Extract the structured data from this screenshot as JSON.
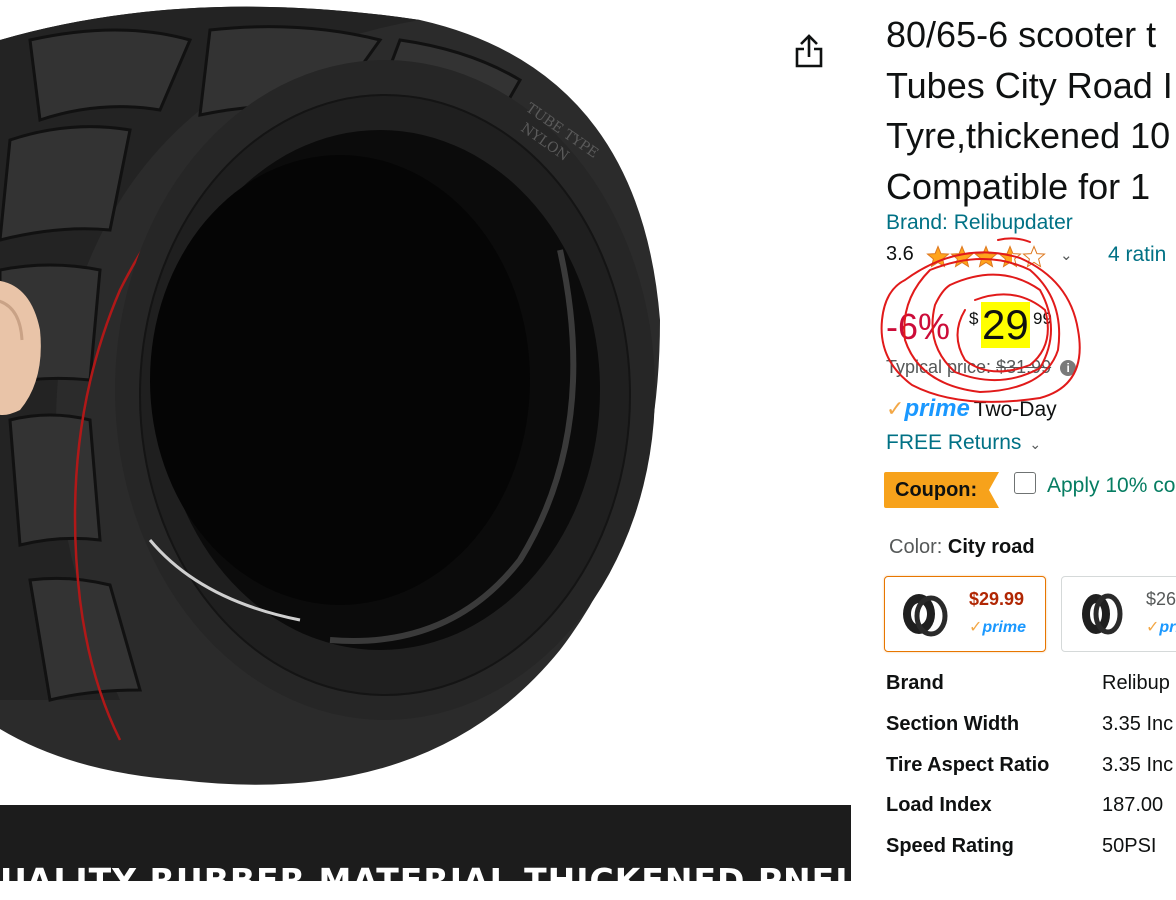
{
  "title": {
    "lines": [
      "80/65-6 scooter t",
      "Tubes City Road I",
      "Tyre,thickened 10",
      "Compatible for 1"
    ]
  },
  "brand": {
    "link_text": "Brand: Relibupdater"
  },
  "rating": {
    "value": "3.6",
    "stars": 3.6,
    "ratings_text": "4 ratin"
  },
  "price": {
    "discount": "-6%",
    "currency": "$",
    "whole": "29",
    "fraction": "99",
    "typical_label": "Typical price:",
    "typical_value": "$31.99"
  },
  "delivery": {
    "prime_label": "prime",
    "prime_delivery": "Two-Day",
    "free_returns": "FREE Returns"
  },
  "coupon": {
    "label": "Coupon:",
    "text": "Apply 10% co"
  },
  "color": {
    "label": "Color:",
    "value": "City road"
  },
  "swatches": [
    {
      "price": "$29.99",
      "prime": "prime"
    },
    {
      "price": "$26",
      "prime": "pri"
    }
  ],
  "specs": [
    {
      "key": "Brand",
      "value": "Relibup"
    },
    {
      "key": "Section Width",
      "value": "3.35 Inc"
    },
    {
      "key": "Tire Aspect Ratio",
      "value": "3.35 Inc"
    },
    {
      "key": "Load Index",
      "value": "187.00"
    },
    {
      "key": "Speed Rating",
      "value": "50PSI"
    }
  ],
  "image": {
    "banner_text": "UALITY RUBBER MATERIAL THICKENED PNEUMATIC TYRES",
    "tire_text": [
      "TUBE TYPE",
      "NYLON"
    ]
  },
  "colors": {
    "link": "#007185",
    "discount": "#cc0c39",
    "price_highlight": "#ffff00",
    "prime": "#1a98ff",
    "prime_check": "#f3a847",
    "coupon_badge": "#f7a21b",
    "coupon_text": "#067d62",
    "selected_border": "#e77600",
    "annotation": "#e11a1a"
  },
  "icons": {
    "share": "share-icon",
    "info": "info-icon",
    "chevron": "chevron-down-icon",
    "star": "star-icon"
  }
}
